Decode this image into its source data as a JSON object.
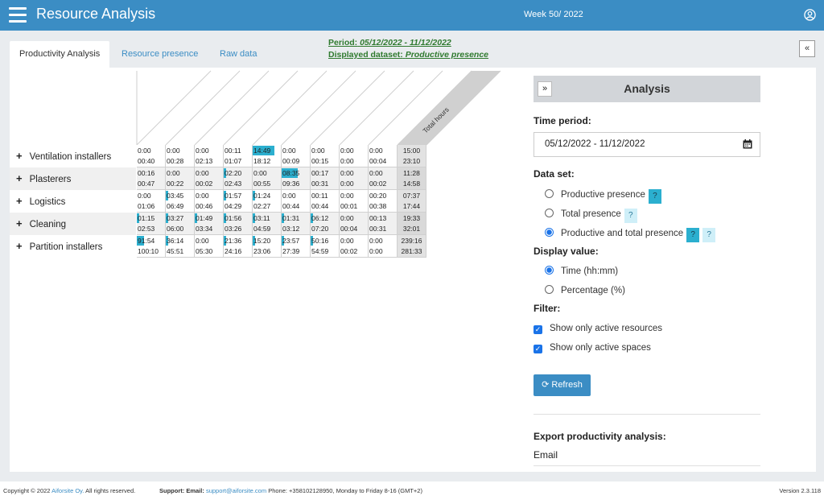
{
  "app": {
    "title": "Resource Analysis",
    "week": "Week 50/ 2022"
  },
  "tabs": [
    {
      "label": "Productivity Analysis",
      "active": true
    },
    {
      "label": "Resource presence",
      "active": false
    },
    {
      "label": "Raw data",
      "active": false
    }
  ],
  "period": {
    "label": "Period:",
    "value": "05/12/2022 - 11/12/2022"
  },
  "dataset": {
    "label": "Displayed dataset:",
    "value": "Productive presence"
  },
  "table": {
    "total_header": "Total hours",
    "rows": [
      {
        "label": "Ventilation installers",
        "cells": [
          {
            "top": "0:00",
            "bottom": "00:40",
            "bar": 0
          },
          {
            "top": "0:00",
            "bottom": "00:28",
            "bar": 0
          },
          {
            "top": "0:00",
            "bottom": "02:13",
            "bar": 0
          },
          {
            "top": "00:11",
            "bottom": "01:07",
            "bar": 0
          },
          {
            "top": "14:49",
            "bottom": "18:12",
            "bar": 0.8
          },
          {
            "top": "0:00",
            "bottom": "00:09",
            "bar": 0
          },
          {
            "top": "0:00",
            "bottom": "00:15",
            "bar": 0
          },
          {
            "top": "0:00",
            "bottom": "0:00",
            "bar": 0
          },
          {
            "top": "0:00",
            "bottom": "00:04",
            "bar": 0
          }
        ],
        "total": {
          "top": "15:00",
          "bottom": "23:10"
        }
      },
      {
        "label": "Plasterers",
        "cells": [
          {
            "top": "00:16",
            "bottom": "00:47",
            "bar": 0
          },
          {
            "top": "0:00",
            "bottom": "00:22",
            "bar": 0
          },
          {
            "top": "0:00",
            "bottom": "00:02",
            "bar": 0
          },
          {
            "top": "02:20",
            "bottom": "02:43",
            "bar": 0.05
          },
          {
            "top": "0:00",
            "bottom": "00:55",
            "bar": 0
          },
          {
            "top": "08:35",
            "bottom": "09:36",
            "bar": 0.6
          },
          {
            "top": "00:17",
            "bottom": "00:31",
            "bar": 0
          },
          {
            "top": "0:00",
            "bottom": "0:00",
            "bar": 0
          },
          {
            "top": "0:00",
            "bottom": "00:02",
            "bar": 0
          }
        ],
        "total": {
          "top": "11:28",
          "bottom": "14:58"
        }
      },
      {
        "label": "Logistics",
        "cells": [
          {
            "top": "0:00",
            "bottom": "01:06",
            "bar": 0
          },
          {
            "top": "03:45",
            "bottom": "06:49",
            "bar": 0.08
          },
          {
            "top": "0:00",
            "bottom": "00:46",
            "bar": 0
          },
          {
            "top": "01:57",
            "bottom": "04:29",
            "bar": 0.05
          },
          {
            "top": "01:24",
            "bottom": "02:27",
            "bar": 0.05
          },
          {
            "top": "0:00",
            "bottom": "00:44",
            "bar": 0
          },
          {
            "top": "00:11",
            "bottom": "00:44",
            "bar": 0
          },
          {
            "top": "0:00",
            "bottom": "00:01",
            "bar": 0
          },
          {
            "top": "00:20",
            "bottom": "00:38",
            "bar": 0
          }
        ],
        "total": {
          "top": "07:37",
          "bottom": "17:44"
        }
      },
      {
        "label": "Cleaning",
        "cells": [
          {
            "top": "01:15",
            "bottom": "02:53",
            "bar": 0.05
          },
          {
            "top": "03:27",
            "bottom": "06:00",
            "bar": 0.08
          },
          {
            "top": "01:49",
            "bottom": "03:34",
            "bar": 0.05
          },
          {
            "top": "01:56",
            "bottom": "03:26",
            "bar": 0.05
          },
          {
            "top": "03:11",
            "bottom": "04:59",
            "bar": 0.08
          },
          {
            "top": "01:31",
            "bottom": "03:12",
            "bar": 0.05
          },
          {
            "top": "06:12",
            "bottom": "07:20",
            "bar": 0.1
          },
          {
            "top": "0:00",
            "bottom": "00:04",
            "bar": 0
          },
          {
            "top": "00:13",
            "bottom": "00:31",
            "bar": 0
          }
        ],
        "total": {
          "top": "19:33",
          "bottom": "32:01"
        }
      },
      {
        "label": "Partition installers",
        "cells": [
          {
            "top": "91:54",
            "bottom": "100:10",
            "bar": 0.25
          },
          {
            "top": "36:14",
            "bottom": "45:51",
            "bar": 0.08
          },
          {
            "top": "0:00",
            "bottom": "05:30",
            "bar": 0
          },
          {
            "top": "21:36",
            "bottom": "24:16",
            "bar": 0.05
          },
          {
            "top": "15:20",
            "bottom": "23:06",
            "bar": 0.05
          },
          {
            "top": "23:57",
            "bottom": "27:39",
            "bar": 0.05
          },
          {
            "top": "50:16",
            "bottom": "54:59",
            "bar": 0.08
          },
          {
            "top": "0:00",
            "bottom": "00:02",
            "bar": 0
          },
          {
            "top": "0:00",
            "bottom": "0:00",
            "bar": 0
          }
        ],
        "total": {
          "top": "239:16",
          "bottom": "281:33"
        }
      }
    ]
  },
  "analysis": {
    "title": "Analysis",
    "time_period_label": "Time period:",
    "time_period_value": "05/12/2022 - 11/12/2022",
    "data_set_label": "Data set:",
    "data_set_options": [
      {
        "label": "Productive presence",
        "selected": false
      },
      {
        "label": "Total presence",
        "selected": false
      },
      {
        "label": "Productive and total presence",
        "selected": true
      }
    ],
    "display_value_label": "Display value:",
    "display_value_options": [
      {
        "label": "Time (hh:mm)",
        "selected": true
      },
      {
        "label": "Percentage (%)",
        "selected": false
      }
    ],
    "filter_label": "Filter:",
    "filters": [
      {
        "label": "Show only active resources",
        "checked": true
      },
      {
        "label": "Show only active spaces",
        "checked": true
      }
    ],
    "refresh_label": "Refresh",
    "export_title": "Export productivity analysis:",
    "email_label": "Email",
    "help_badge": "?"
  },
  "footer": {
    "copyright": "Copyright © 2022",
    "company": "Aiforsite Oy.",
    "rights": "All rights reserved.",
    "support_label": "Support: Email:",
    "support_email": "support@aiforsite.com",
    "phone": "Phone: +358102128950, Monday to Friday 8-16 (GMT+2)",
    "version": "Version 2.3.118"
  },
  "colors": {
    "primary": "#3b8dc4",
    "bar": "#2bafcf",
    "period": "#2f7a2f"
  }
}
